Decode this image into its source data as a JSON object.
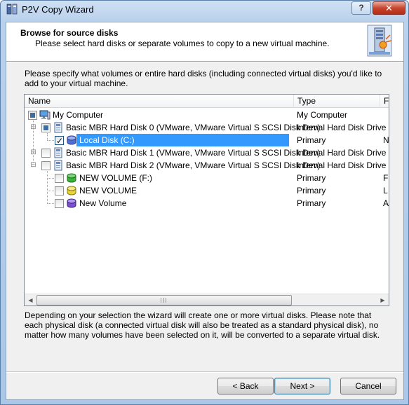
{
  "window": {
    "title": "P2V Copy Wizard",
    "help_label": "?",
    "close_label": "✕"
  },
  "header": {
    "title": "Browse for source disks",
    "subtitle": "Please select hard disks or separate volumes to copy to a new virtual machine."
  },
  "instructions": "Please specify what volumes or entire hard disks (including connected virtual disks) you'd like to add to your virtual machine.",
  "tree": {
    "columns": [
      "Name",
      "Type",
      "F"
    ],
    "rows": [
      {
        "name": "My Computer",
        "type": "My Computer",
        "extra": "",
        "icon": "computer-icon",
        "check": "partial"
      },
      {
        "name": "Basic MBR Hard Disk 0 (VMware, VMware Virtual S SCSI Disk Dev)",
        "type": "Internal Hard Disk Drive",
        "extra": "",
        "icon": "hard-disk-icon",
        "check": "partial"
      },
      {
        "name": "Local Disk (C:)",
        "type": "Primary",
        "extra": "N",
        "icon": "volume-icon",
        "check": "checked",
        "selected": true
      },
      {
        "name": "Basic MBR Hard Disk 1 (VMware, VMware Virtual S SCSI Disk Dev)",
        "type": "Internal Hard Disk Drive",
        "extra": "",
        "icon": "hard-disk-icon",
        "check": "unchecked"
      },
      {
        "name": "Basic MBR Hard Disk 2 (VMware, VMware Virtual S SCSI Disk Dev)",
        "type": "Internal Hard Disk Drive",
        "extra": "",
        "icon": "hard-disk-icon",
        "check": "unchecked"
      },
      {
        "name": "NEW VOLUME (F:)",
        "type": "Primary",
        "extra": "F",
        "icon": "volume-icon",
        "check": "unchecked"
      },
      {
        "name": "NEW VOLUME",
        "type": "Primary",
        "extra": "L",
        "icon": "volume-icon",
        "check": "unchecked"
      },
      {
        "name": "New Volume",
        "type": "Primary",
        "extra": "A",
        "icon": "volume-icon",
        "check": "unchecked"
      }
    ],
    "scroll_left": "◀",
    "scroll_right": "▶"
  },
  "note": "Depending on your selection the wizard will create one or more virtual disks. Please note that each physical disk (a connected virtual disk will also be treated as a standard physical disk), no matter how many volumes have been selected on it, will be converted to a separate virtual disk.",
  "buttons": {
    "back": "< Back",
    "next": "Next >",
    "cancel": "Cancel"
  },
  "colors": {
    "selection": "#3399ff",
    "volume_c": "#4f6fd6",
    "volume_f": "#38b538",
    "volume_new": "#e6d23a",
    "volume_new2": "#7a4fd0"
  }
}
